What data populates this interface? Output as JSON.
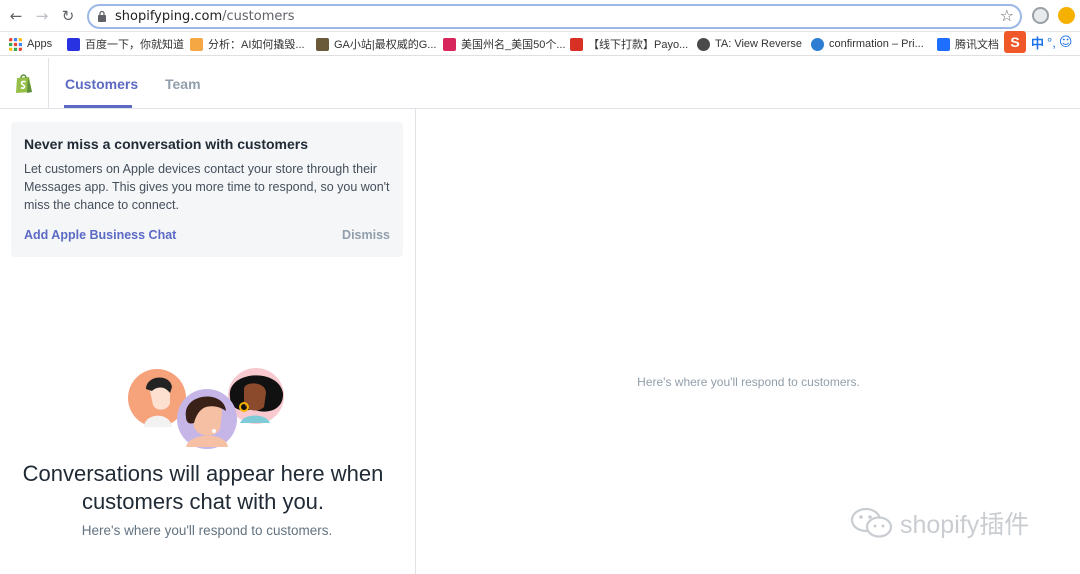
{
  "browser": {
    "url_host": "shopifyping.com",
    "url_path": "/customers",
    "bookmarks": [
      {
        "label": "Apps",
        "color": "#e04a3f"
      },
      {
        "label": "百度一下，你就知道",
        "color": "#2932e1"
      },
      {
        "label": "分析：AI如何撬毁...",
        "color": "#f4a742"
      },
      {
        "label": "GA小站|最权威的G...",
        "color": "#6b5a3a"
      },
      {
        "label": "美国州名_美国50个...",
        "color": "#d6265c"
      },
      {
        "label": "【线下打款】Payo...",
        "color": "#d93025"
      },
      {
        "label": "TA: View Reverse",
        "color": "#4a4a4a"
      },
      {
        "label": "confirmation – Pri...",
        "color": "#2d7dd2"
      },
      {
        "label": "腾讯文档",
        "color": "#1e6fff"
      }
    ],
    "ime_label": "中"
  },
  "nav": {
    "tabs": [
      {
        "label": "Customers",
        "active": true
      },
      {
        "label": "Team",
        "active": false
      }
    ]
  },
  "banner": {
    "title": "Never miss a conversation with customers",
    "body": "Let customers on Apple devices contact your store through their Messages app. This gives you more time to respond, so you won't miss the chance to connect.",
    "cta_label": "Add Apple Business Chat",
    "dismiss_label": "Dismiss"
  },
  "empty_state": {
    "title": "Conversations will appear here when customers chat with you.",
    "subtitle": "Here's where you'll respond to customers."
  },
  "detail": {
    "placeholder": "Here's where you'll respond to customers."
  },
  "watermark": {
    "text": "shopify插件"
  },
  "colors": {
    "accent": "#5c6ac4",
    "shopify_green": "#95bf47"
  }
}
